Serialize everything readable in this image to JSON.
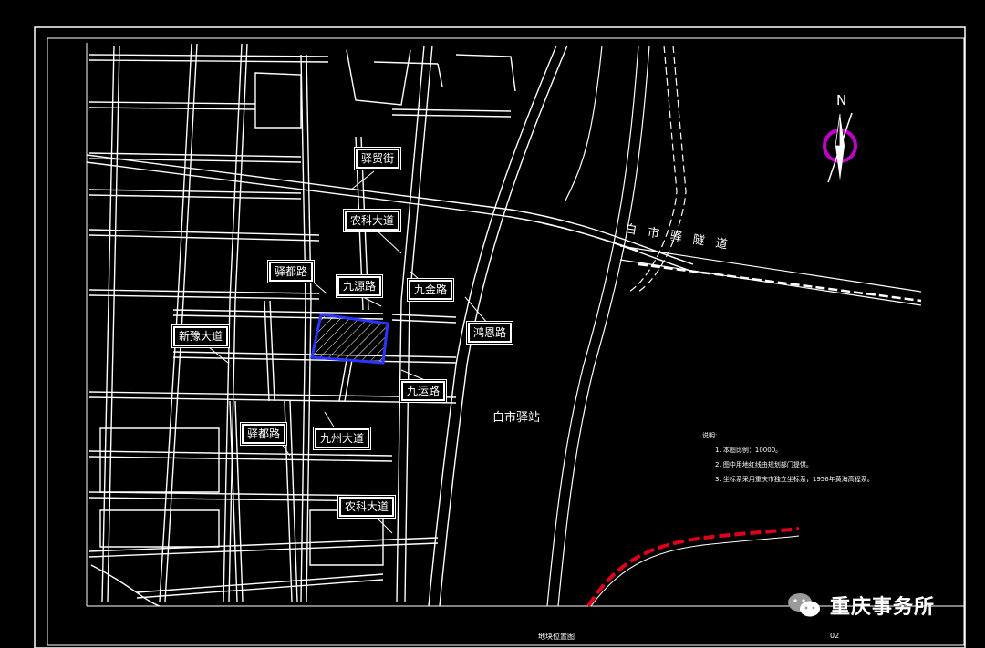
{
  "colors": {
    "background": "#000000",
    "roads": "#ffffff",
    "site": "#2a36ff",
    "rail": "#e0001a",
    "compass": "#c000c8"
  },
  "compass": {
    "north_label": "N"
  },
  "road_labels": {
    "yimao": "驿贸街",
    "nongke_1": "农科大道",
    "yidu_1": "驿都路",
    "jiuyuan": "九源路",
    "jiujin": "九金路",
    "hongen": "鸿恩路",
    "xinyu": "新豫大道",
    "jiuyun": "九运路",
    "yidu_2": "驿都路",
    "jiuzhou": "九州大道",
    "nongke_2": "农科大道"
  },
  "area_labels": {
    "baishiyi_station": "白市驿站",
    "tunnel": "白 市 驿 隧 道"
  },
  "notes": {
    "title": "说明:",
    "lines": [
      "1. 本图比例：10000。",
      "2. 图中用地红线由规划部门提供。",
      "3. 坐标系采用重庆市独立坐标系，1956年黄海高程系。"
    ]
  },
  "footer": {
    "title": "地块位置图",
    "page": "02"
  },
  "watermark": {
    "text": "重庆事务所",
    "icon": "wechat-icon"
  }
}
